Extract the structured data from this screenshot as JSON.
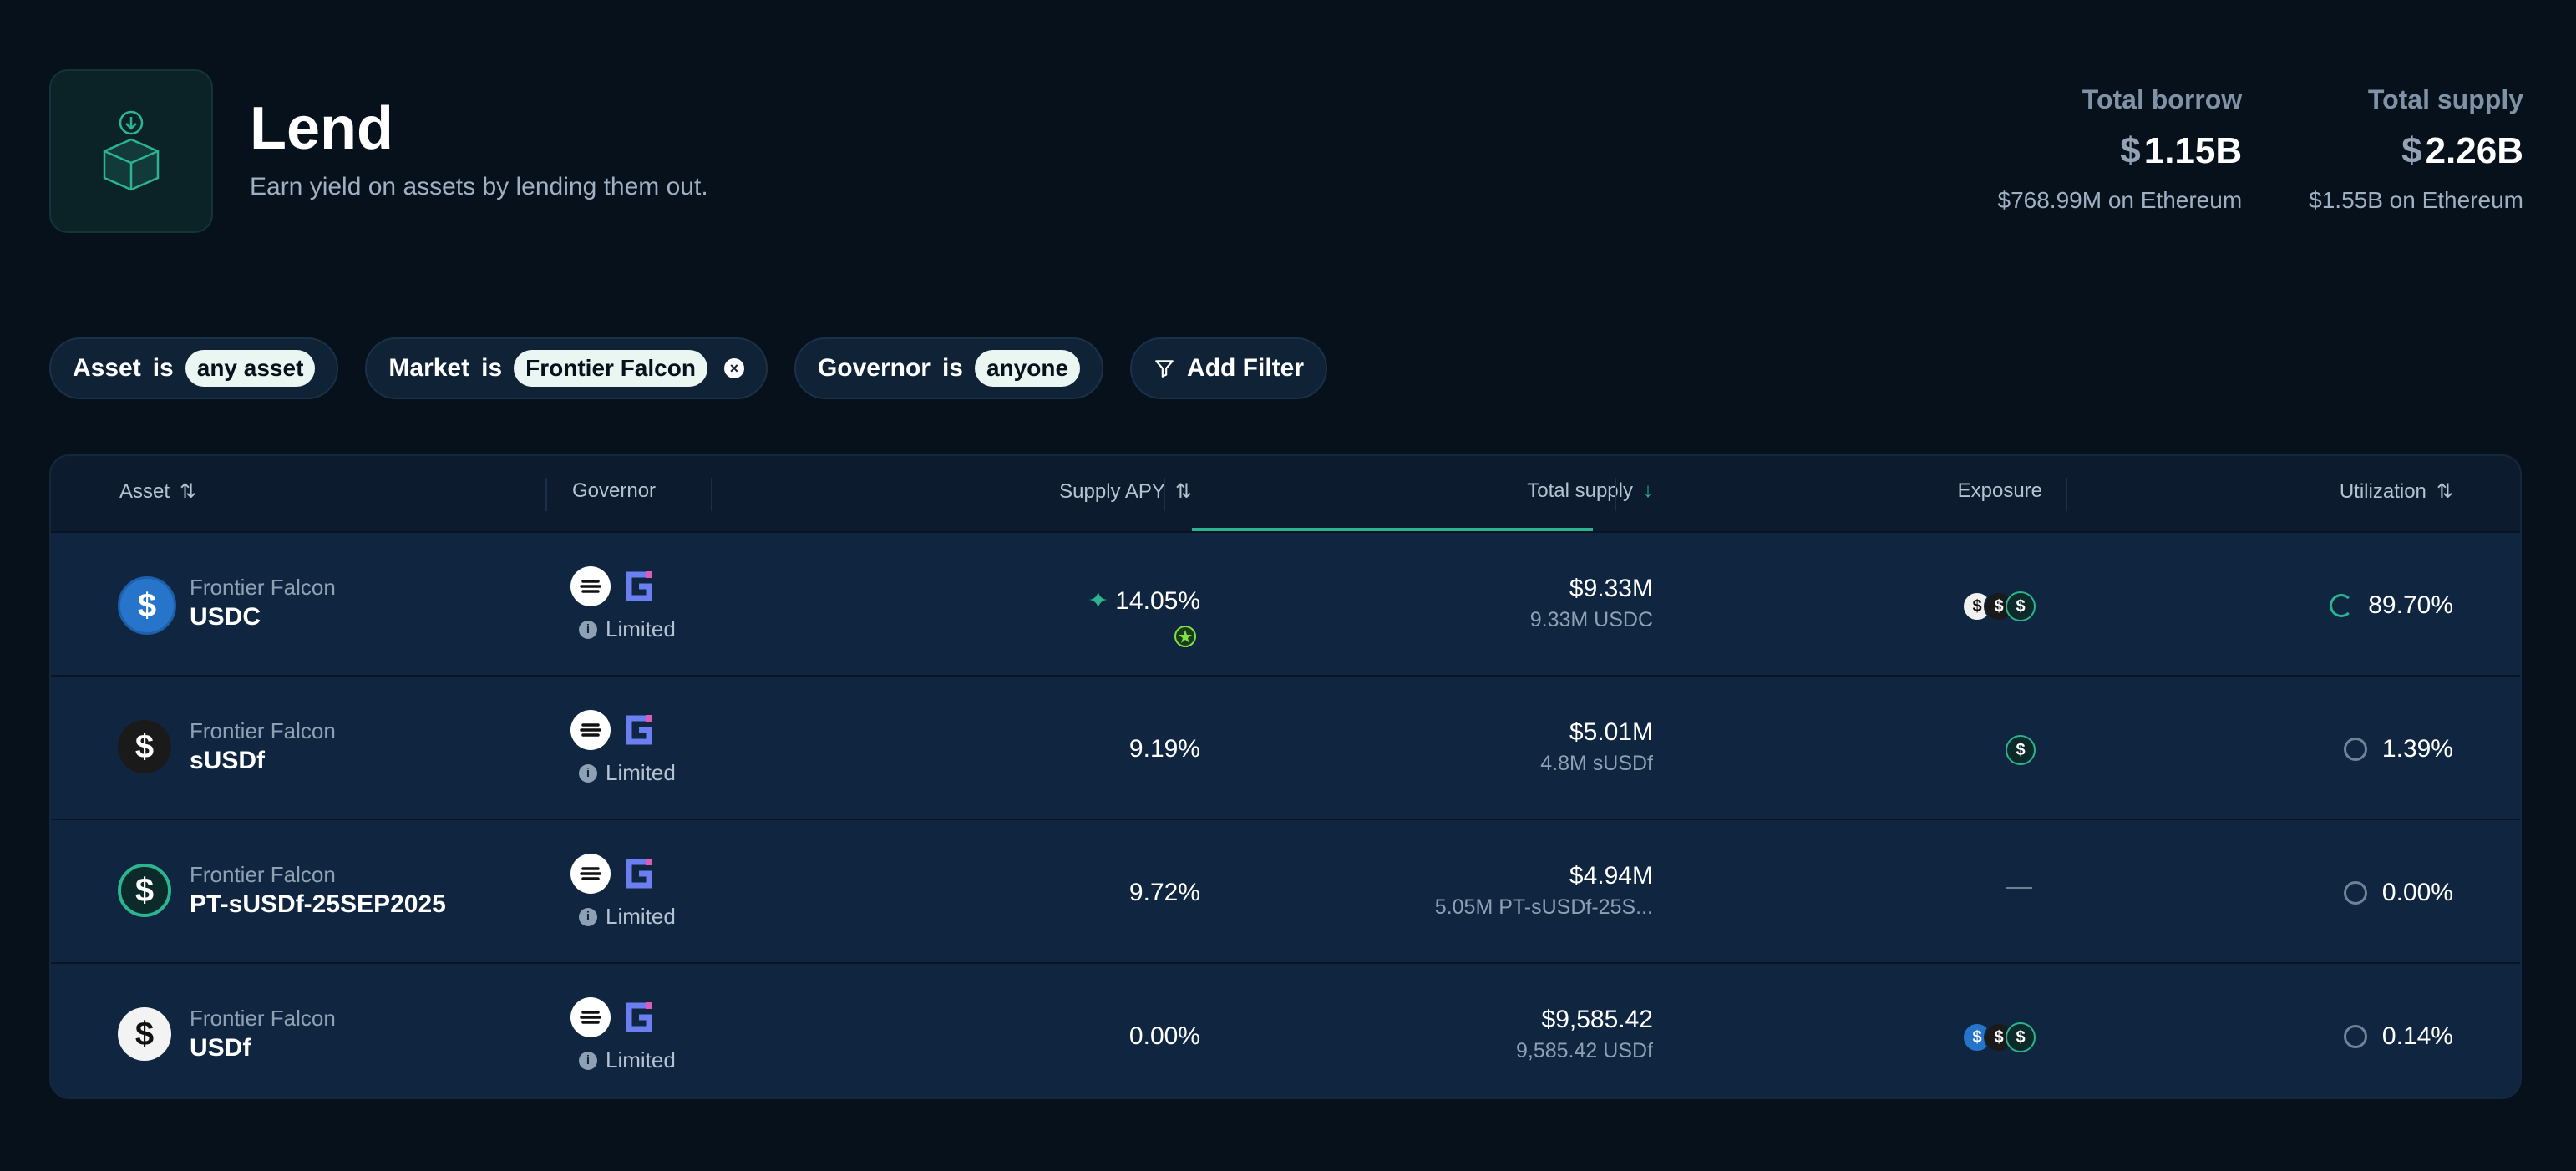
{
  "header": {
    "title": "Lend",
    "subtitle": "Earn yield on assets by lending them out.",
    "logo_icon": "box-download-icon"
  },
  "stats": {
    "borrow": {
      "label": "Total borrow",
      "currency": "$",
      "value": "1.15B",
      "sub": "$768.99M on Ethereum"
    },
    "supply": {
      "label": "Total supply",
      "currency": "$",
      "value": "2.26B",
      "sub": "$1.55B on Ethereum"
    }
  },
  "filters": {
    "asset": {
      "field": "Asset",
      "op": "is",
      "value": "any asset"
    },
    "market": {
      "field": "Market",
      "op": "is",
      "value": "Frontier Falcon"
    },
    "governor": {
      "field": "Governor",
      "op": "is",
      "value": "anyone"
    },
    "add": {
      "label": "Add Filter"
    }
  },
  "table": {
    "columns": {
      "asset": "Asset",
      "governor": "Governor",
      "apy": "Supply APY",
      "supply": "Total supply",
      "exposure": "Exposure",
      "utilization": "Utilization"
    },
    "rows": [
      {
        "market": "Frontier Falcon",
        "asset": "USDC",
        "governance": "Limited",
        "apy": "14.05%",
        "supply": "$9.33M",
        "supply_native": "9.33M USDC",
        "utilization": "89.70%",
        "util_fraction": 0.897,
        "exposure": [
          "USDf",
          "sUSDf",
          "PT-sUSDf"
        ]
      },
      {
        "market": "Frontier Falcon",
        "asset": "sUSDf",
        "governance": "Limited",
        "apy": "9.19%",
        "supply": "$5.01M",
        "supply_native": "4.8M sUSDf",
        "utilization": "1.39%",
        "util_fraction": 0.0139,
        "exposure": [
          "PT-sUSDf"
        ]
      },
      {
        "market": "Frontier Falcon",
        "asset": "PT-sUSDf-25SEP2025",
        "governance": "Limited",
        "apy": "9.72%",
        "supply": "$4.94M",
        "supply_native": "5.05M PT-sUSDf-25S...",
        "utilization": "0.00%",
        "util_fraction": 0,
        "exposure": []
      },
      {
        "market": "Frontier Falcon",
        "asset": "USDf",
        "governance": "Limited",
        "apy": "0.00%",
        "supply": "$9,585.42",
        "supply_native": "9,585.42 USDf",
        "utilization": "0.14%",
        "util_fraction": 0.0014,
        "exposure": [
          "USDC",
          "sUSDf",
          "PT-sUSDf"
        ]
      }
    ]
  },
  "colors": {
    "accent": "#2bb48f",
    "background": "#07111c",
    "row": "#0f2540"
  }
}
